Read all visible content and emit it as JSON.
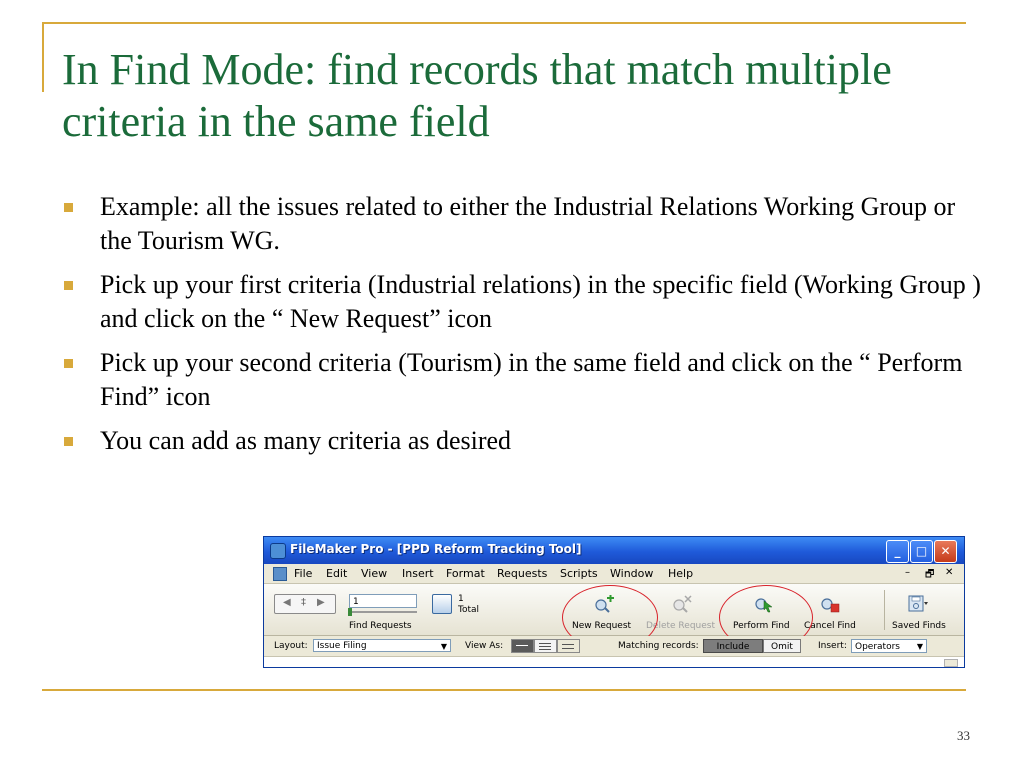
{
  "slide": {
    "title": "In Find Mode: find records that match multiple criteria in the same field",
    "bullets": [
      "Example: all the issues related to either the Industrial Relations Working Group or the Tourism WG.",
      "Pick up your first criteria (Industrial relations) in the specific field (Working Group ) and click on the “ New Request” icon",
      "Pick up your second criteria (Tourism) in the same field and click on the “ Perform Find” icon",
      "You can add as many criteria as desired"
    ],
    "page_number": "33",
    "colors": {
      "title": "#1b6b3a",
      "accent": "#d8a93b"
    }
  },
  "screenshot": {
    "window_title": "FileMaker Pro - [PPD Reform Tracking Tool]",
    "window_buttons": {
      "minimize": "_",
      "maximize": "□",
      "close": "✕"
    },
    "menu": [
      "File",
      "Edit",
      "View",
      "Insert",
      "Format",
      "Requests",
      "Scripts",
      "Window",
      "Help"
    ],
    "mdi_buttons": [
      "–",
      "🗗",
      "✕"
    ],
    "toolbar": {
      "record_value": "1",
      "find_requests_label": "Find Requests",
      "total_count": "1",
      "total_label": "Total",
      "new_request": "New Request",
      "delete_request": "Delete Request",
      "perform_find": "Perform Find",
      "cancel_find": "Cancel Find",
      "saved_finds": "Saved Finds"
    },
    "statusbar": {
      "layout_label": "Layout:",
      "layout_value": "Issue Filing",
      "view_as_label": "View As:",
      "matching_label": "Matching records:",
      "include": "Include",
      "omit": "Omit",
      "insert_label": "Insert:",
      "operators": "Operators"
    },
    "icons": [
      "book-icon",
      "find-requests-stack-icon",
      "new-request-icon",
      "delete-request-icon",
      "perform-find-icon",
      "cancel-find-icon",
      "saved-finds-icon"
    ],
    "highlight_color": "#d8242c"
  }
}
